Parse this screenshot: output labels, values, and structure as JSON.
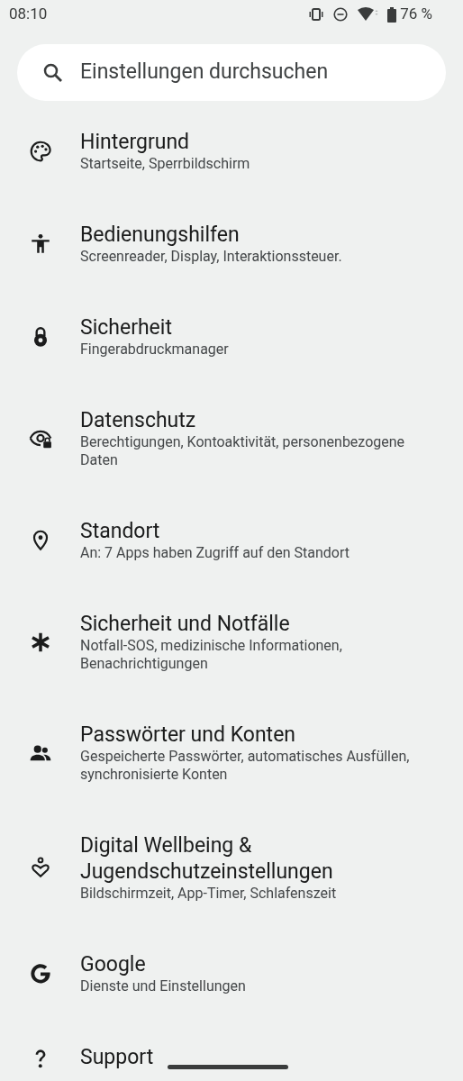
{
  "status_bar": {
    "time": "08:10",
    "battery": "76 %"
  },
  "search": {
    "placeholder": "Einstellungen durchsuchen"
  },
  "items": [
    {
      "title": "Hintergrund",
      "subtitle": "Startseite, Sperrbildschirm"
    },
    {
      "title": "Bedienungshilfen",
      "subtitle": "Screenreader, Display, Interaktionssteuer."
    },
    {
      "title": "Sicherheit",
      "subtitle": "Fingerabdruckmanager"
    },
    {
      "title": "Datenschutz",
      "subtitle": "Berechtigungen, Kontoaktivität, personenbezogene Daten"
    },
    {
      "title": "Standort",
      "subtitle": "An: 7 Apps haben Zugriff auf den Standort"
    },
    {
      "title": "Sicherheit und Notfälle",
      "subtitle": "Notfall-SOS, medizinische Informationen, Benachrichtigungen"
    },
    {
      "title": "Passwörter und Konten",
      "subtitle": "Gespeicherte Passwörter, automatisches Ausfüllen, synchronisierte Konten"
    },
    {
      "title": "Digital Wellbeing & Jugendschutzeinstellungen",
      "subtitle": "Bildschirmzeit, App-Timer, Schlafenszeit"
    },
    {
      "title": "Google",
      "subtitle": "Dienste und Einstellungen"
    },
    {
      "title": "Support"
    }
  ]
}
